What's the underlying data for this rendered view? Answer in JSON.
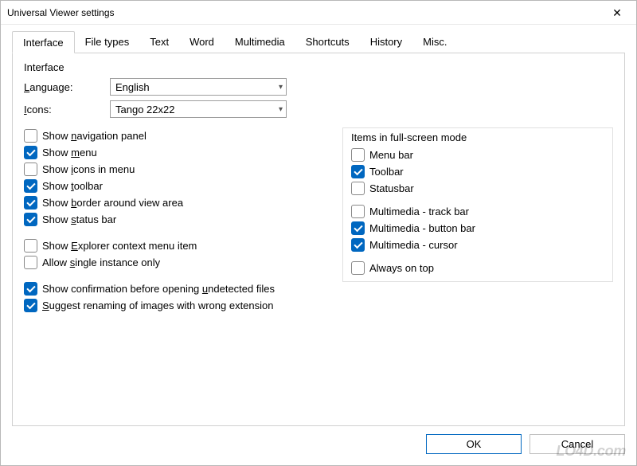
{
  "title": "Universal Viewer settings",
  "tabs": [
    "Interface",
    "File types",
    "Text",
    "Word",
    "Multimedia",
    "Shortcuts",
    "History",
    "Misc."
  ],
  "active_tab": 0,
  "group": {
    "heading": "Interface",
    "language_label": "Language:",
    "language_value": "English",
    "icons_label": "Icons:",
    "icons_value": "Tango 22x22"
  },
  "left": [
    {
      "label": "Show navigation panel",
      "u": 5,
      "checked": false
    },
    {
      "label": "Show menu",
      "u": 5,
      "checked": true
    },
    {
      "label": "Show icons in menu",
      "u": 5,
      "checked": false
    },
    {
      "label": "Show toolbar",
      "u": 5,
      "checked": true
    },
    {
      "label": "Show border around view area",
      "u": 5,
      "checked": true
    },
    {
      "label": "Show status bar",
      "u": 5,
      "checked": true
    }
  ],
  "left2": [
    {
      "label": "Show Explorer context menu item",
      "u": 5,
      "checked": false
    },
    {
      "label": "Allow single instance only",
      "u": 6,
      "checked": false
    }
  ],
  "left3": [
    {
      "label": "Show confirmation before opening undetected files",
      "u": 33,
      "checked": true
    },
    {
      "label": "Suggest renaming of images with wrong extension",
      "u": 0,
      "checked": true
    }
  ],
  "right_heading": "Items in full-screen mode",
  "right": [
    {
      "label": "Menu bar",
      "checked": false
    },
    {
      "label": "Toolbar",
      "checked": true
    },
    {
      "label": "Statusbar",
      "checked": false
    }
  ],
  "right2": [
    {
      "label": "Multimedia - track bar",
      "checked": false
    },
    {
      "label": "Multimedia - button bar",
      "checked": true
    },
    {
      "label": "Multimedia - cursor",
      "checked": true
    }
  ],
  "right3": [
    {
      "label": "Always on top",
      "checked": false
    }
  ],
  "buttons": {
    "ok": "OK",
    "cancel": "Cancel"
  },
  "watermark": "LO4D.com"
}
